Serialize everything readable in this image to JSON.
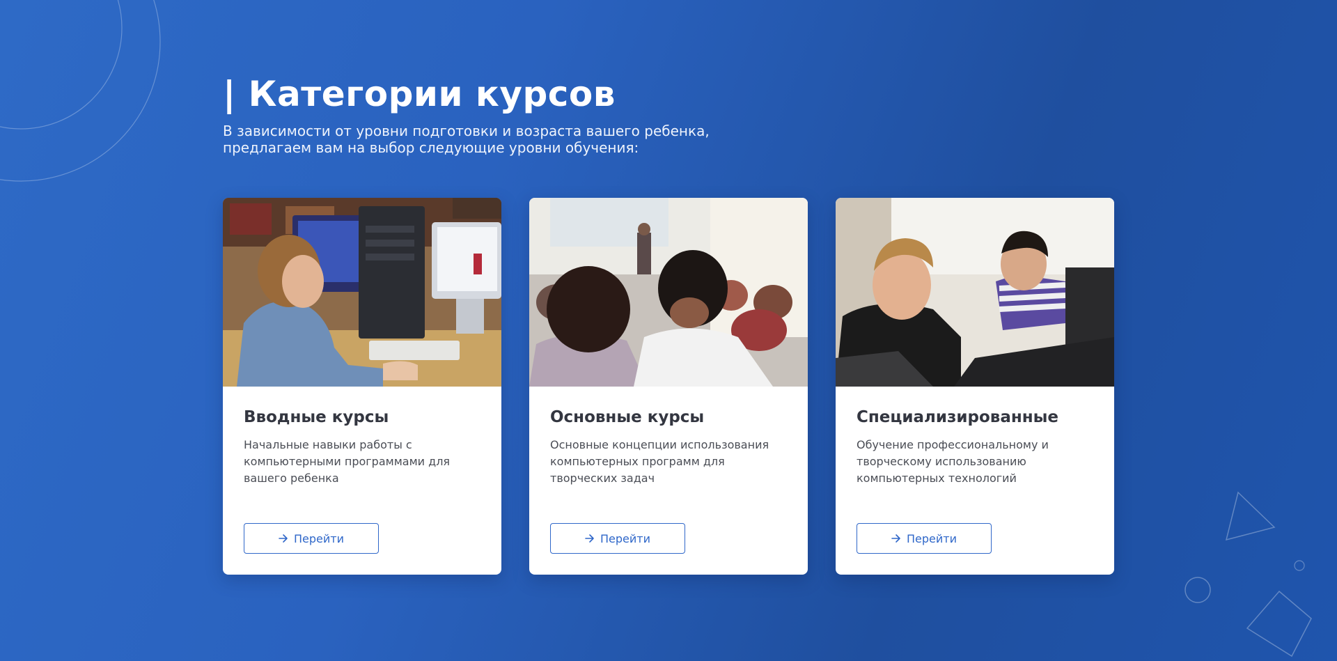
{
  "header": {
    "title": "| Категории курсов",
    "subtitle": "В зависимости от уровни подготовки и возраста вашего ребенка, предлагаем вам на выбор следующие уровни обучения:"
  },
  "cards": [
    {
      "title": "Вводные курсы",
      "text": "Начальные навыки работы с компьютерными программами для вашего ребенка",
      "button_label": "Перейти",
      "button_icon": "arrow-right-icon",
      "image": "photo-child-at-computer"
    },
    {
      "title": "Основные курсы",
      "text": "Основные концепции использования компьютерных программ для творческих задач",
      "button_label": "Перейти",
      "button_icon": "arrow-right-icon",
      "image": "photo-students-in-auditorium"
    },
    {
      "title": "Специализированные",
      "text": "Обучение профессиональному и творческому использованию компьютерных технологий",
      "button_label": "Перейти",
      "button_icon": "arrow-right-icon",
      "image": "photo-teens-at-computer"
    }
  ],
  "colors": {
    "background": "#2a62bf",
    "accent": "#2f67c9",
    "card_title": "#333640",
    "card_text": "#4a4d55"
  }
}
